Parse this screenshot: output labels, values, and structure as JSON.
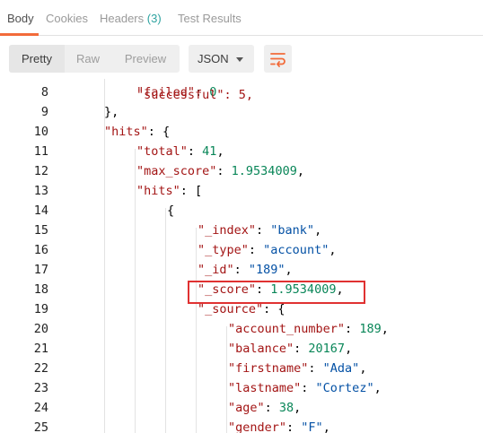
{
  "tabs": [
    {
      "label": "Body"
    },
    {
      "label": "Cookies"
    },
    {
      "label": "Headers",
      "count": "(3)"
    },
    {
      "label": "Test Results"
    }
  ],
  "toolbar": {
    "pretty": "Pretty",
    "raw": "Raw",
    "preview": "Preview",
    "format": "JSON",
    "wrap_icon": "wrap-lines-icon"
  },
  "code_lines": [
    {
      "n": "8",
      "parts": [
        [
          "k",
          "\"failed\""
        ],
        [
          "p",
          ": "
        ],
        [
          "n",
          "0"
        ]
      ]
    },
    {
      "n": "9",
      "parts": [
        [
          "p",
          "},"
        ]
      ]
    },
    {
      "n": "10",
      "parts": [
        [
          "k",
          "\"hits\""
        ],
        [
          "p",
          ": {"
        ]
      ]
    },
    {
      "n": "11",
      "parts": [
        [
          "k",
          "\"total\""
        ],
        [
          "p",
          ": "
        ],
        [
          "n",
          "41"
        ],
        [
          "p",
          ","
        ]
      ]
    },
    {
      "n": "12",
      "parts": [
        [
          "k",
          "\"max_score\""
        ],
        [
          "p",
          ": "
        ],
        [
          "n",
          "1.9534009"
        ],
        [
          "p",
          ","
        ]
      ]
    },
    {
      "n": "13",
      "parts": [
        [
          "k",
          "\"hits\""
        ],
        [
          "p",
          ": ["
        ]
      ]
    },
    {
      "n": "14",
      "parts": [
        [
          "p",
          "{"
        ]
      ]
    },
    {
      "n": "15",
      "parts": [
        [
          "k",
          "\"_index\""
        ],
        [
          "p",
          ": "
        ],
        [
          "s",
          "\"bank\""
        ],
        [
          "p",
          ","
        ]
      ]
    },
    {
      "n": "16",
      "parts": [
        [
          "k",
          "\"_type\""
        ],
        [
          "p",
          ": "
        ],
        [
          "s",
          "\"account\""
        ],
        [
          "p",
          ","
        ]
      ]
    },
    {
      "n": "17",
      "parts": [
        [
          "k",
          "\"_id\""
        ],
        [
          "p",
          ": "
        ],
        [
          "s",
          "\"189\""
        ],
        [
          "p",
          ","
        ]
      ]
    },
    {
      "n": "18",
      "parts": [
        [
          "k",
          "\"_score\""
        ],
        [
          "p",
          ": "
        ],
        [
          "n",
          "1.9534009"
        ],
        [
          "p",
          ","
        ]
      ]
    },
    {
      "n": "19",
      "parts": [
        [
          "k",
          "\"_source\""
        ],
        [
          "p",
          ": {"
        ]
      ]
    },
    {
      "n": "20",
      "parts": [
        [
          "k",
          "\"account_number\""
        ],
        [
          "p",
          ": "
        ],
        [
          "n",
          "189"
        ],
        [
          "p",
          ","
        ]
      ]
    },
    {
      "n": "21",
      "parts": [
        [
          "k",
          "\"balance\""
        ],
        [
          "p",
          ": "
        ],
        [
          "n",
          "20167"
        ],
        [
          "p",
          ","
        ]
      ]
    },
    {
      "n": "22",
      "parts": [
        [
          "k",
          "\"firstname\""
        ],
        [
          "p",
          ": "
        ],
        [
          "s",
          "\"Ada\""
        ],
        [
          "p",
          ","
        ]
      ]
    },
    {
      "n": "23",
      "parts": [
        [
          "k",
          "\"lastname\""
        ],
        [
          "p",
          ": "
        ],
        [
          "s",
          "\"Cortez\""
        ],
        [
          "p",
          ","
        ]
      ]
    },
    {
      "n": "24",
      "parts": [
        [
          "k",
          "\"age\""
        ],
        [
          "p",
          ": "
        ],
        [
          "n",
          "38"
        ],
        [
          "p",
          ","
        ]
      ]
    },
    {
      "n": "25",
      "parts": [
        [
          "k",
          "\"gender\""
        ],
        [
          "p",
          ": "
        ],
        [
          "s",
          "\"F\""
        ],
        [
          "p",
          ","
        ]
      ]
    }
  ],
  "highlighted_line": "18",
  "colors": {
    "accent_tab": "#f26b3a",
    "key": "#a31515",
    "string": "#0451a5",
    "number": "#098658",
    "highlight_border": "#e03131"
  }
}
